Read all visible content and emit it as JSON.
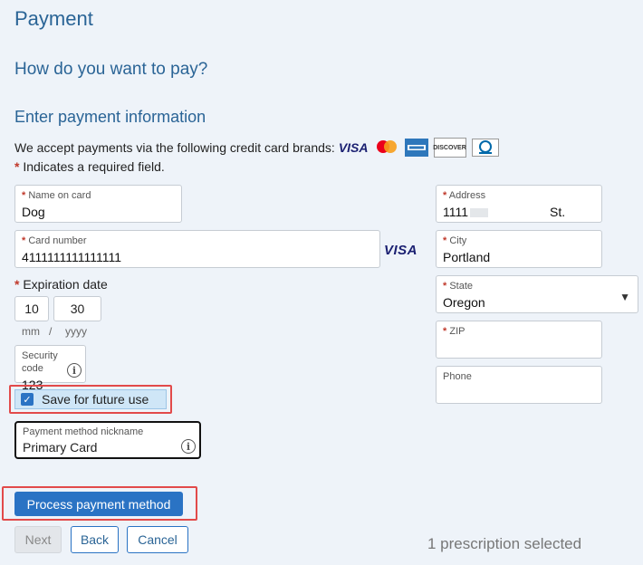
{
  "page": {
    "title": "Payment",
    "subtitle": "How do you want to pay?",
    "section_title": "Enter payment information",
    "accept_text": "We accept payments via the following credit card brands:",
    "card_brands": [
      "VISA",
      "Mastercard",
      "American Express",
      "DISCOVER",
      "Diners Club"
    ],
    "required_note": "Indicates a required field."
  },
  "form": {
    "name_on_card": {
      "label": "Name on card",
      "value": "Dog"
    },
    "card_number": {
      "label": "Card number",
      "value": "4111111111111111",
      "brand": "VISA"
    },
    "expiration": {
      "label": "Expiration date",
      "month": "10",
      "year": "30",
      "month_hint": "mm",
      "separator": "/",
      "year_hint": "yyyy"
    },
    "security_code": {
      "label": "Security code",
      "value": "123"
    },
    "save_future": {
      "label": "Save for future use",
      "checked": true
    },
    "nickname": {
      "label": "Payment method nickname",
      "value": "Primary Card"
    },
    "address": {
      "label": "Address",
      "value_start": "1111",
      "value_end": "St."
    },
    "city": {
      "label": "City",
      "value": "Portland"
    },
    "state": {
      "label": "State",
      "value": "Oregon"
    },
    "zip": {
      "label": "ZIP",
      "value": ""
    },
    "phone": {
      "label": "Phone",
      "value": ""
    }
  },
  "actions": {
    "process": "Process payment method",
    "next": "Next",
    "back": "Back",
    "cancel": "Cancel"
  },
  "status": {
    "prescriptions": "1 prescription selected"
  },
  "colors": {
    "accent": "#2a73c4",
    "heading": "#2a6496",
    "highlight": "#e24a4a",
    "background": "#eef3f9"
  }
}
